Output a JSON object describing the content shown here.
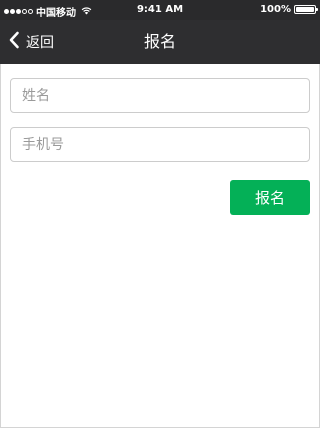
{
  "status_bar": {
    "carrier": "中国移动",
    "time": "9:41 AM",
    "battery": "100%",
    "icons": [
      "signal-icon",
      "wifi-icon",
      "battery-icon"
    ]
  },
  "nav": {
    "back_label": "返回",
    "title": "报名",
    "back_icon": "chevron-left-icon"
  },
  "form": {
    "name_placeholder": "姓名",
    "phone_placeholder": "手机号",
    "name_value": "",
    "phone_value": "",
    "submit_label": "报名"
  },
  "colors": {
    "nav_background": "#2e2e30",
    "submit_background": "#04b057",
    "field_border": "#cccccc"
  }
}
